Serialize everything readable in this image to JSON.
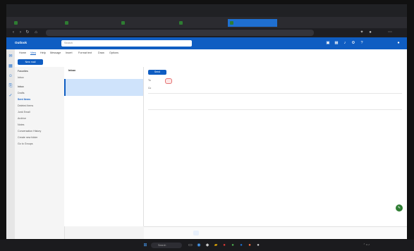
{
  "browser": {
    "window_title": "",
    "tabs": [
      {
        "label": "",
        "active": false
      },
      {
        "label": "",
        "active": false
      },
      {
        "label": "",
        "active": false
      },
      {
        "label": "",
        "active": false
      },
      {
        "label": "",
        "active": true
      }
    ],
    "address": ""
  },
  "outlook": {
    "brand": "Outlook",
    "search_placeholder": "Search",
    "ribbon_tabs": [
      "Home",
      "View",
      "Help",
      "Message",
      "Insert",
      "Format text",
      "Draw",
      "Options"
    ],
    "new_mail_label": "New mail",
    "ribbon_buttons": [
      "",
      "",
      ""
    ],
    "folders": [
      {
        "label": "Favorites",
        "type": "hdr"
      },
      {
        "label": "Inbox",
        "type": "item"
      },
      {
        "label": "Inbox",
        "type": "sel"
      },
      {
        "label": "Drafts",
        "type": "item"
      },
      {
        "label": "Sent Items",
        "type": "item"
      },
      {
        "label": "Deleted Items",
        "type": "item"
      },
      {
        "label": "Junk Email",
        "type": "item"
      },
      {
        "label": "Archive",
        "type": "item"
      },
      {
        "label": "Notes",
        "type": "item"
      },
      {
        "label": "Conversation History",
        "type": "item"
      },
      {
        "label": "Create new folder",
        "type": "item"
      },
      {
        "label": "Go to Groups",
        "type": "item"
      }
    ]
  },
  "message_list": {
    "header": "Inbox",
    "groups": [
      "",
      "",
      ""
    ],
    "messages": [
      {
        "sender": "",
        "subject": "",
        "preview": "",
        "time": "",
        "selected": true
      },
      {
        "sender": "",
        "subject": "",
        "preview": "",
        "time": "",
        "selected": false
      },
      {
        "sender": "",
        "subject": "",
        "preview": "",
        "time": "",
        "selected": false
      },
      {
        "sender": "",
        "subject": "",
        "preview": "",
        "time": "",
        "selected": false
      },
      {
        "sender": "",
        "subject": "",
        "preview": "",
        "time": "",
        "selected": false
      },
      {
        "sender": "",
        "subject": "",
        "preview": "",
        "time": "",
        "selected": false
      }
    ]
  },
  "compose": {
    "send_label": "Send",
    "to_label": "To",
    "cc_label": "Cc",
    "recipient": "",
    "draft_note": "",
    "draft_time": "",
    "body_lines": [
      "",
      "",
      "",
      "",
      "",
      "",
      "",
      "",
      "",
      "",
      "",
      ""
    ]
  },
  "bottom": {
    "tab1": "",
    "tab2": ""
  },
  "taskbar": {
    "search_label": "Search",
    "clock": ""
  },
  "colors": {
    "accent": "#0f5dc2",
    "flag_red": "#c62828"
  }
}
